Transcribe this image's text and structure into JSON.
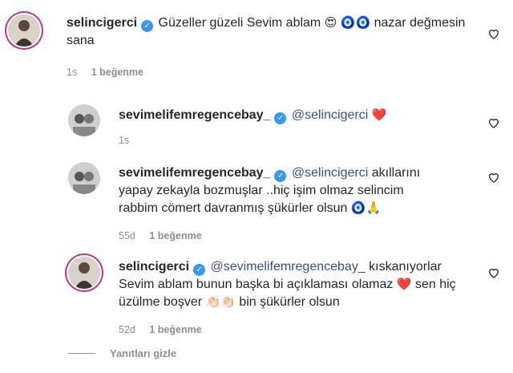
{
  "comments": [
    {
      "username": "selincigerci",
      "text_before": "Güzeller güzeli Sevim ablam ",
      "emoji_a": "😍",
      "emoji_b": "🧿🧿",
      "text_after": " nazar değmesin sana",
      "time": "1s",
      "likes": "1 beğenme"
    },
    {
      "username": "sevimelifemregencebay_",
      "mention": "@selincigerci",
      "text": "",
      "emoji": "❤️",
      "time": "1s"
    },
    {
      "username": "sevimelifemregencebay_",
      "mention": "@selincigerci",
      "text": " akıllarını yapay zekayla bozmuşlar ..hiç işim olmaz selincim rabbim cömert davranmış şükürler olsun",
      "emoji": "🧿🙏",
      "time": "55d",
      "likes": "1 beğenme"
    },
    {
      "username": "selincigerci",
      "mention": "@sevimelifemregencebay_",
      "text": " kıskanıyorlar Sevim ablam bunun başka bi açıklaması olamaz ",
      "emoji_a": "❤️",
      "text_mid": "sen hiç üzülme boşver ",
      "emoji_b": "👏🏻👏🏻",
      "text_after": "bin şükürler olsun",
      "time": "52d",
      "likes": "1 beğenme"
    }
  ],
  "hide_replies_label": "Yanıtları gizle",
  "verified_mark": "✓",
  "colors": {
    "verified": "#3897f0",
    "mention": "#385185",
    "meta": "#8e8e8e",
    "story_ring": "#c13584"
  },
  "icons": {
    "like": "heart-outline-icon",
    "verified": "verified-badge-icon"
  }
}
